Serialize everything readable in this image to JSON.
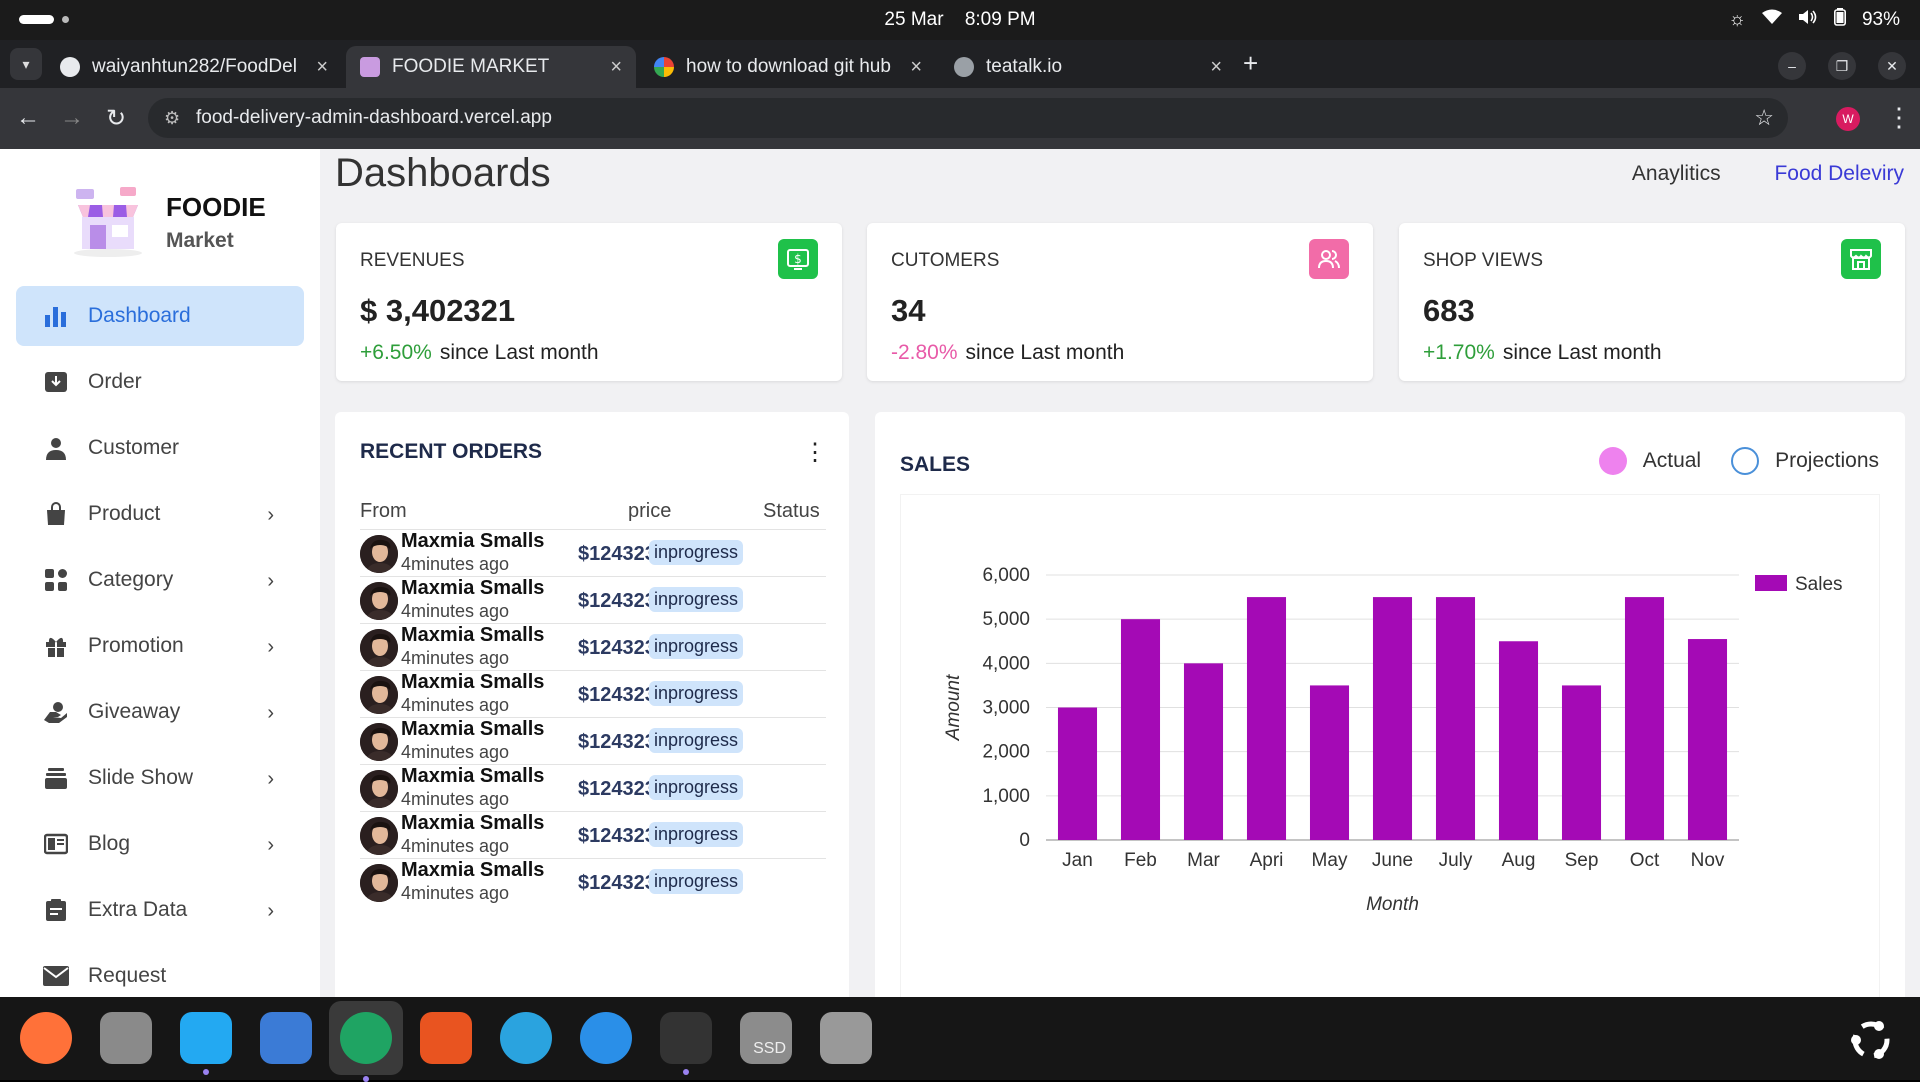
{
  "system": {
    "date": "25 Mar",
    "time": "8:09 PM",
    "battery": "93%"
  },
  "tabs": [
    {
      "title": "waiyanhtun282/FoodDel",
      "favicon": "github-icon"
    },
    {
      "title": "FOODIE MARKET",
      "favicon": "foodie-icon"
    },
    {
      "title": "how to download git hub",
      "favicon": "google-icon"
    },
    {
      "title": "teatalk.io",
      "favicon": "globe-icon"
    }
  ],
  "browser": {
    "url": "food-delivery-admin-dashboard.vercel.app",
    "profile_initial": "W"
  },
  "brand": {
    "title": "FOODIE",
    "subtitle": "Market"
  },
  "sidebar": {
    "items": [
      {
        "label": "Dashboard",
        "icon": "bar-chart-icon",
        "active": true,
        "has_children": false
      },
      {
        "label": "Order",
        "icon": "inbox-download-icon",
        "has_children": false
      },
      {
        "label": "Customer",
        "icon": "person-icon",
        "has_children": false
      },
      {
        "label": "Product",
        "icon": "shopping-bag-icon",
        "has_children": true
      },
      {
        "label": "Category",
        "icon": "grid-icon",
        "has_children": true
      },
      {
        "label": "Promotion",
        "icon": "gift-icon",
        "has_children": true
      },
      {
        "label": "Giveaway",
        "icon": "hand-coin-icon",
        "has_children": true
      },
      {
        "label": "Slide Show",
        "icon": "layers-icon",
        "has_children": true
      },
      {
        "label": "Blog",
        "icon": "book-icon",
        "has_children": true
      },
      {
        "label": "Extra Data",
        "icon": "clipboard-icon",
        "has_children": true
      },
      {
        "label": "Request",
        "icon": "mail-icon",
        "has_children": false
      }
    ]
  },
  "header": {
    "title": "Dashboards",
    "links": [
      "Anaylitics",
      "Food Deleviry"
    ]
  },
  "stats": [
    {
      "label": "REVENUES",
      "value": "$ 3,402321",
      "change": "+6.50%",
      "change_color": "#2e9e3a",
      "suffix": "since Last month",
      "icon": "dollar-icon",
      "icon_color": "#1fc14a"
    },
    {
      "label": "CUTOMERS",
      "value": "34",
      "change": "-2.80%",
      "change_color": "#e85aa8",
      "suffix": "since Last month",
      "icon": "users-icon",
      "icon_color": "#f26ca8"
    },
    {
      "label": "SHOP VIEWS",
      "value": "683",
      "change": "+1.70%",
      "change_color": "#2e9e3a",
      "suffix": "since Last month",
      "icon": "store-icon",
      "icon_color": "#1fc14a"
    }
  ],
  "orders": {
    "title": "RECENT ORDERS",
    "columns": [
      "From",
      "price",
      "Status"
    ],
    "rows": [
      {
        "name": "Maxmia Smalls",
        "time": "4minutes ago",
        "price": "$124323",
        "status": "inprogress"
      },
      {
        "name": "Maxmia Smalls",
        "time": "4minutes ago",
        "price": "$124323",
        "status": "inprogress"
      },
      {
        "name": "Maxmia Smalls",
        "time": "4minutes ago",
        "price": "$124323",
        "status": "inprogress"
      },
      {
        "name": "Maxmia Smalls",
        "time": "4minutes ago",
        "price": "$124323",
        "status": "inprogress"
      },
      {
        "name": "Maxmia Smalls",
        "time": "4minutes ago",
        "price": "$124323",
        "status": "inprogress"
      },
      {
        "name": "Maxmia Smalls",
        "time": "4minutes ago",
        "price": "$124323",
        "status": "inprogress"
      },
      {
        "name": "Maxmia Smalls",
        "time": "4minutes ago",
        "price": "$124323",
        "status": "inprogress"
      },
      {
        "name": "Maxmia Smalls",
        "time": "4minutes ago",
        "price": "$124323",
        "status": "inprogress"
      }
    ]
  },
  "sales": {
    "title": "SALES",
    "legend": [
      {
        "label": "Actual",
        "color": "#ee82ee",
        "filled": true
      },
      {
        "label": "Projections",
        "color": "#4a90d9",
        "filled": false
      }
    ]
  },
  "chart_data": {
    "type": "bar",
    "categories": [
      "Jan",
      "Feb",
      "Mar",
      "Apri",
      "May",
      "June",
      "July",
      "Aug",
      "Sep",
      "Oct",
      "Nov"
    ],
    "series": [
      {
        "name": "Sales",
        "values": [
          3000,
          5000,
          4000,
          5500,
          3500,
          5500,
          5500,
          4500,
          3500,
          5500,
          4550
        ],
        "color": "#a40ab5"
      }
    ],
    "xlabel": "Month",
    "ylabel": "Amount",
    "ylim": [
      0,
      6000
    ],
    "yticks": [
      "0",
      "1,000",
      "2,000",
      "3,000",
      "4,000",
      "5,000",
      "6,000"
    ],
    "grid": true,
    "legend_position": "top-right"
  },
  "dock": [
    {
      "name": "firefox-icon",
      "color": "#ff7139"
    },
    {
      "name": "files-icon",
      "color": "#8a8a8a"
    },
    {
      "name": "vscode-icon",
      "color": "#23a9f2"
    },
    {
      "name": "text-editor-icon",
      "color": "#3b7bd6"
    },
    {
      "name": "chrome-icon",
      "color": "#1fa463",
      "active": true
    },
    {
      "name": "app-center-icon",
      "color": "#e95420"
    },
    {
      "name": "telegram-icon",
      "color": "#2aa3df"
    },
    {
      "name": "help-icon",
      "color": "#2a8fe8"
    },
    {
      "name": "terminal-icon",
      "color": "#333333"
    },
    {
      "name": "ssd-drive-icon",
      "color": "#8c8c8c",
      "label": "SSD"
    },
    {
      "name": "trash-icon",
      "color": "#999999"
    }
  ]
}
